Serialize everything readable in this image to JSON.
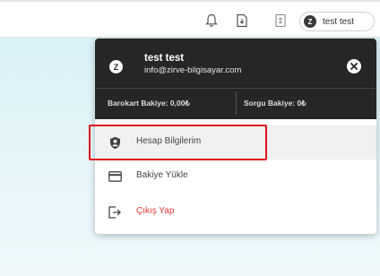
{
  "topbar": {
    "icons": [
      "bell-icon",
      "document-download-icon",
      "receipt-icon"
    ],
    "user_chip": {
      "avatar_letter": "Z",
      "name": "test test"
    }
  },
  "dropdown": {
    "avatar_letter": "Z",
    "name": "test test",
    "email": "info@zirve-bilgisayar.com",
    "close_icon": "close-icon",
    "balances": {
      "barokart": "Barokart Bakiye: 0,00₺",
      "sorgu": "Sorgu Bakiye: 0₺"
    },
    "items": [
      {
        "label": "Hesap Bilgilerim",
        "icon": "account-shield-icon",
        "active": true
      },
      {
        "label": "Bakiye Yükle",
        "icon": "credit-card-icon",
        "active": false
      },
      {
        "label": "Çıkış Yap",
        "icon": "logout-icon",
        "active": false
      }
    ]
  },
  "colors": {
    "header_bg": "#262626",
    "danger": "#e53935",
    "highlight": "#e0141b",
    "page_bg": "#d9f1f7"
  }
}
